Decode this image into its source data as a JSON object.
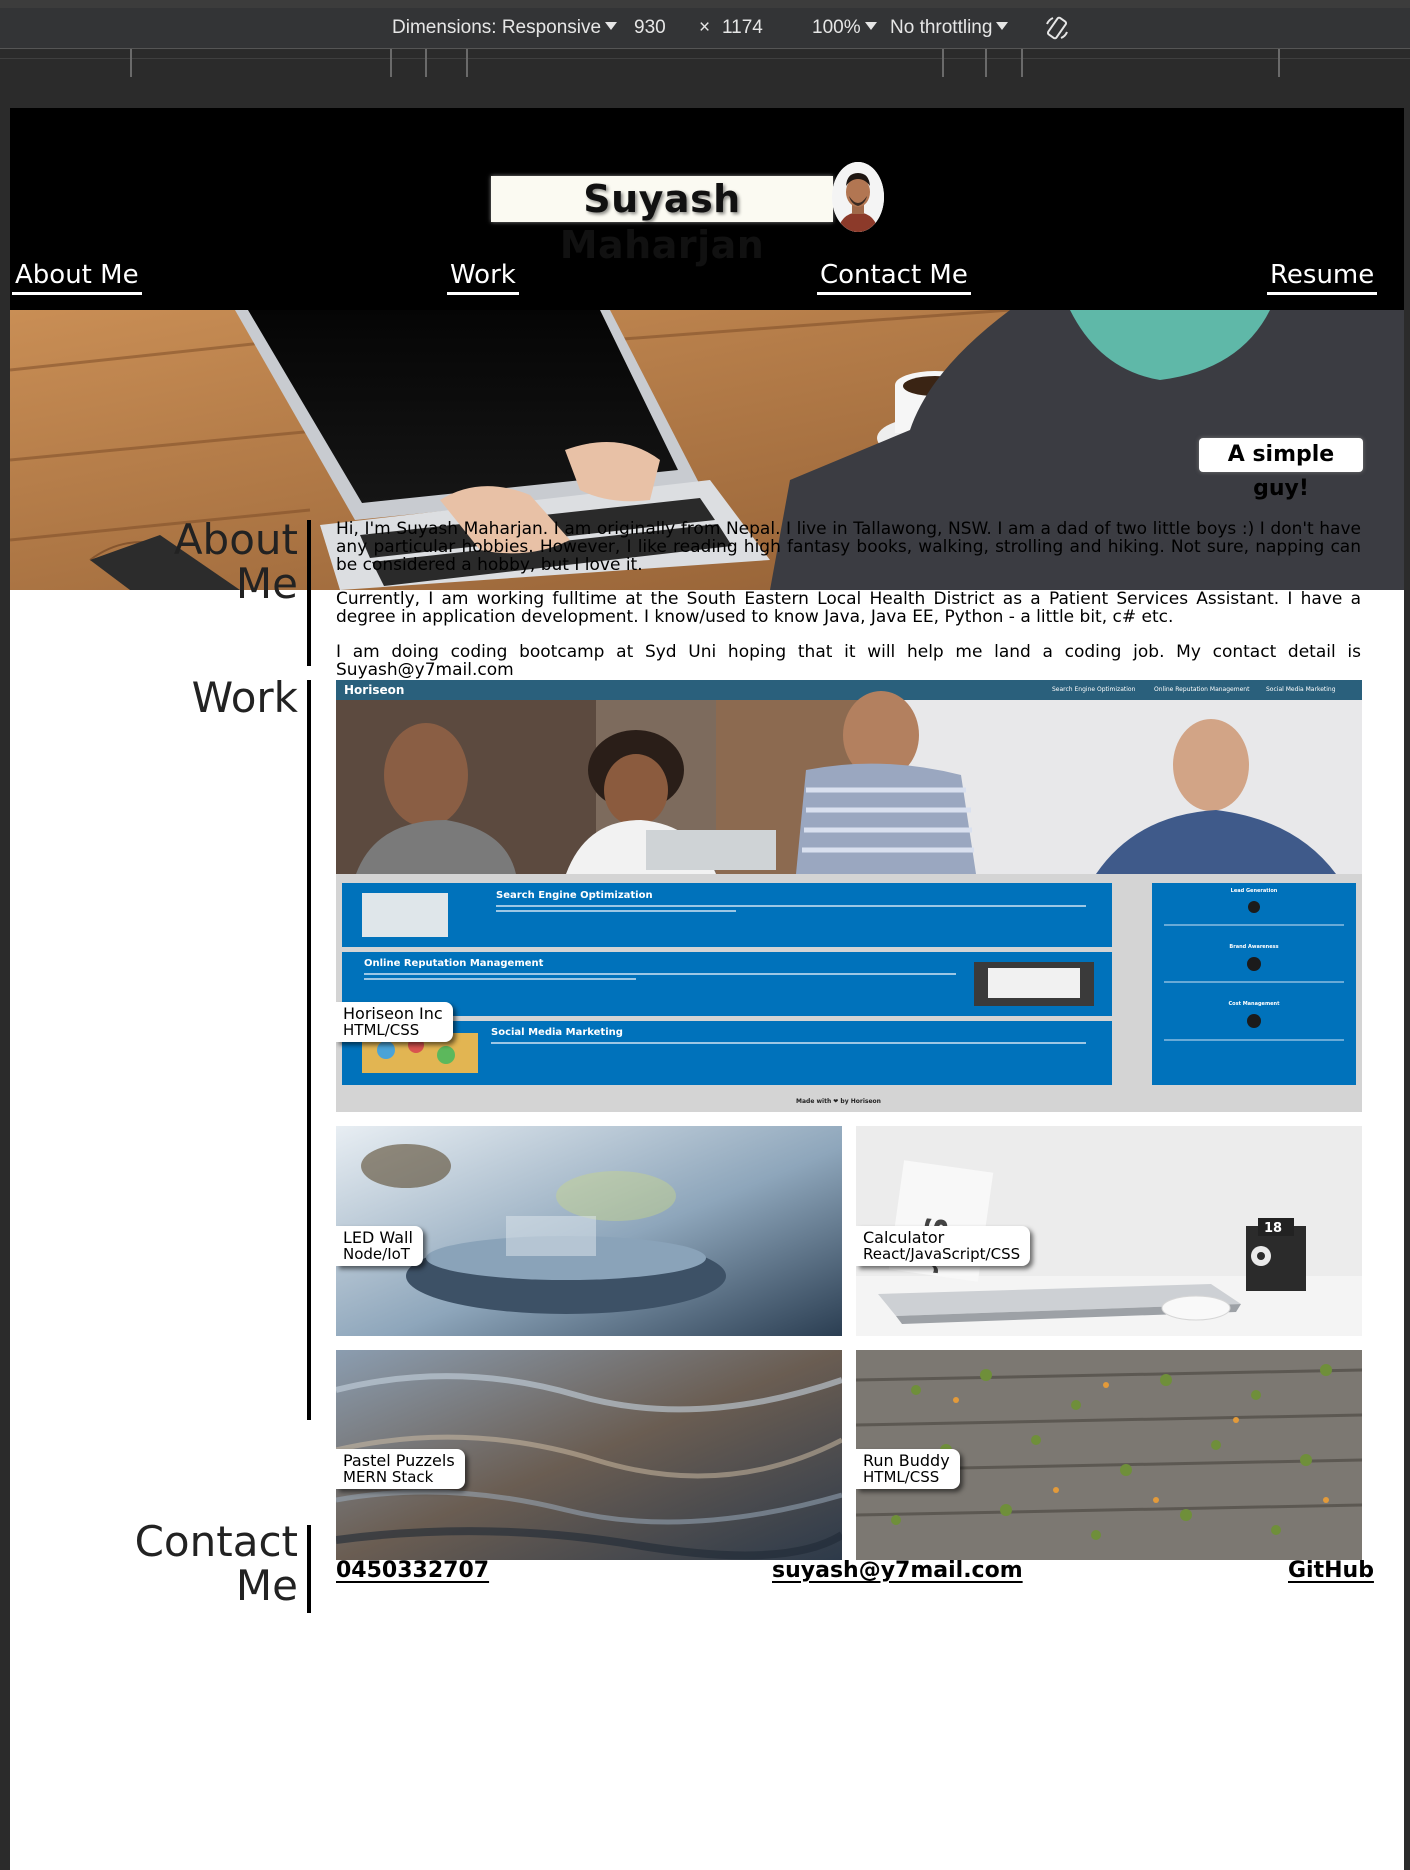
{
  "devtools": {
    "dimensions_label": "Dimensions: Responsive",
    "width": "930",
    "times": "×",
    "height": "1174",
    "zoom": "100%",
    "throttling": "No throttling",
    "rotate_icon": "rotate-icon"
  },
  "site": {
    "title": "Suyash Maharjan",
    "nav": {
      "about": "About Me",
      "work": "Work",
      "contact": "Contact Me",
      "resume": "Resume"
    },
    "tagline": "A simple guy!"
  },
  "about": {
    "heading_line1": "About",
    "heading_line2": "Me",
    "paragraphs": [
      "Hi, I'm Suyash Maharjan. I am originally from Nepal. I live in Tallawong, NSW. I am a dad of two little boys :) I don't have any particular hobbies. However, I like reading high fantasy books, walking, strolling and hiking. Not sure, napping can be considered a hobby, but I love it.",
      "Currently, I am working fulltime at the South Eastern Local Health District as a Patient Services Assistant. I have a degree in application development. I know/used to know Java, Java EE, Python - a little bit, c# etc.",
      "I am doing coding bootcamp at Syd Uni hoping that it will help me land a coding job. My contact detail is Suyash@y7mail.com"
    ]
  },
  "work": {
    "heading": "Work",
    "projects": [
      {
        "name": "Horiseon Inc",
        "stack": "HTML/CSS"
      },
      {
        "name": "LED Wall",
        "stack": "Node/IoT"
      },
      {
        "name": "Calculator",
        "stack": "React/JavaScript/CSS"
      },
      {
        "name": "Pastel Puzzels",
        "stack": "MERN Stack"
      },
      {
        "name": "Run Buddy",
        "stack": "HTML/CSS"
      }
    ],
    "horiseon_shot": {
      "brand": "Horiseon",
      "nav": [
        "Search Engine Optimization",
        "Online Reputation Management",
        "Social Media Marketing"
      ],
      "sections": [
        "Search Engine Optimization",
        "Online Reputation Management",
        "Social Media Marketing"
      ],
      "benefits": [
        "Lead Generation",
        "Brand Awareness",
        "Cost Management"
      ],
      "footer": "Made with ❤ by Horiseon"
    }
  },
  "contact": {
    "heading_line1": "Contact",
    "heading_line2": "Me",
    "phone": "0450332707",
    "email": "suyash@y7mail.com",
    "github": "GitHub"
  },
  "colors": {
    "header_bg": "#000000",
    "title_bg": "#fbfaf2",
    "horiseon_blue": "#0072bb",
    "horiseon_dark": "#2a607c"
  }
}
